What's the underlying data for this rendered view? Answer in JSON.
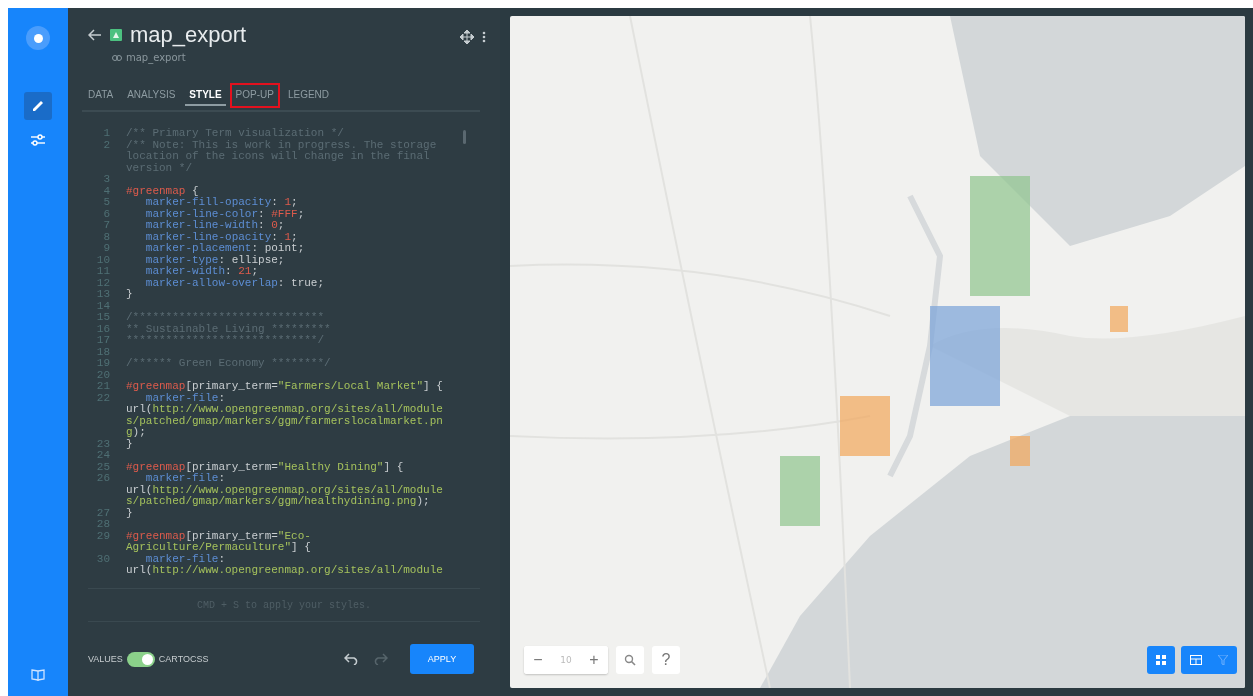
{
  "sidebar": {
    "items": [
      {
        "kind": "edit",
        "selected": true
      },
      {
        "kind": "settings",
        "selected": false
      }
    ]
  },
  "header": {
    "title": "map_export",
    "subtitle": "map_export"
  },
  "tabs": [
    {
      "label": "DATA",
      "selected": false,
      "highlighted": false
    },
    {
      "label": "ANALYSIS",
      "selected": false,
      "highlighted": false
    },
    {
      "label": "STYLE",
      "selected": true,
      "highlighted": false
    },
    {
      "label": "POP-UP",
      "selected": false,
      "highlighted": true
    },
    {
      "label": "LEGEND",
      "selected": false,
      "highlighted": false
    }
  ],
  "editor": {
    "lines": [
      {
        "num": "1",
        "parts": [
          {
            "kind": "comment",
            "text": "/** Primary Term visualization */"
          }
        ]
      },
      {
        "num": "2",
        "parts": [
          {
            "kind": "comment",
            "text": "/** Note: This is work in progress. The storage location of the icons will change in the final version */"
          }
        ]
      },
      {
        "num": "3"
      },
      {
        "num": "4",
        "parts": [
          {
            "kind": "selector",
            "text": "#greenmap"
          },
          {
            "kind": "plain",
            "text": " {"
          }
        ]
      },
      {
        "num": "5",
        "parts": [
          {
            "kind": "property",
            "text": "   marker-fill-opacity"
          },
          {
            "kind": "plain",
            "text": ": "
          },
          {
            "kind": "number",
            "text": "1"
          },
          {
            "kind": "plain",
            "text": ";"
          }
        ]
      },
      {
        "num": "6",
        "parts": [
          {
            "kind": "property",
            "text": "   marker-line-color"
          },
          {
            "kind": "plain",
            "text": ": "
          },
          {
            "kind": "number",
            "text": "#FFF"
          },
          {
            "kind": "plain",
            "text": ";"
          }
        ]
      },
      {
        "num": "7",
        "parts": [
          {
            "kind": "property",
            "text": "   marker-line-width"
          },
          {
            "kind": "plain",
            "text": ": "
          },
          {
            "kind": "number",
            "text": "0"
          },
          {
            "kind": "plain",
            "text": ";"
          }
        ]
      },
      {
        "num": "8",
        "parts": [
          {
            "kind": "property",
            "text": "   marker-line-opacity"
          },
          {
            "kind": "plain",
            "text": ": "
          },
          {
            "kind": "number",
            "text": "1"
          },
          {
            "kind": "plain",
            "text": ";"
          }
        ]
      },
      {
        "num": "9",
        "parts": [
          {
            "kind": "property",
            "text": "   marker-placement"
          },
          {
            "kind": "plain",
            "text": ": point;"
          }
        ]
      },
      {
        "num": "10",
        "parts": [
          {
            "kind": "property",
            "text": "   marker-type"
          },
          {
            "kind": "plain",
            "text": ": ellipse;"
          }
        ]
      },
      {
        "num": "11",
        "parts": [
          {
            "kind": "property",
            "text": "   marker-width"
          },
          {
            "kind": "plain",
            "text": ": "
          },
          {
            "kind": "number",
            "text": "21"
          },
          {
            "kind": "plain",
            "text": ";"
          }
        ]
      },
      {
        "num": "12",
        "parts": [
          {
            "kind": "property",
            "text": "   marker-allow-overlap"
          },
          {
            "kind": "plain",
            "text": ": true;"
          }
        ]
      },
      {
        "num": "13",
        "parts": [
          {
            "kind": "plain",
            "text": "}"
          }
        ]
      },
      {
        "num": "14"
      },
      {
        "num": "15",
        "parts": [
          {
            "kind": "comment",
            "text": "/*****************************"
          }
        ]
      },
      {
        "num": "16",
        "parts": [
          {
            "kind": "comment",
            "text": "** Sustainable Living *********"
          }
        ]
      },
      {
        "num": "17",
        "parts": [
          {
            "kind": "comment",
            "text": "*****************************/"
          }
        ]
      },
      {
        "num": "18"
      },
      {
        "num": "19",
        "parts": [
          {
            "kind": "comment",
            "text": "/****** Green Economy ********/"
          }
        ]
      },
      {
        "num": "20"
      },
      {
        "num": "21",
        "parts": [
          {
            "kind": "selector",
            "text": "#greenmap"
          },
          {
            "kind": "plain",
            "text": "[primary_term="
          },
          {
            "kind": "string",
            "text": "\"Farmers/Local Market\""
          },
          {
            "kind": "plain",
            "text": "] {"
          }
        ]
      },
      {
        "num": "22",
        "parts": [
          {
            "kind": "property",
            "text": "   marker-file"
          },
          {
            "kind": "plain",
            "text": ": url("
          },
          {
            "kind": "string",
            "text": "http://www.opengreenmap.org/sites/all/modules/patched/gmap/markers/ggm/farmerslocalmarket.png"
          },
          {
            "kind": "plain",
            "text": ");"
          }
        ]
      },
      {
        "num": "23",
        "parts": [
          {
            "kind": "plain",
            "text": "}"
          }
        ]
      },
      {
        "num": "24"
      },
      {
        "num": "25",
        "parts": [
          {
            "kind": "selector",
            "text": "#greenmap"
          },
          {
            "kind": "plain",
            "text": "[primary_term="
          },
          {
            "kind": "string",
            "text": "\"Healthy Dining\""
          },
          {
            "kind": "plain",
            "text": "] {"
          }
        ]
      },
      {
        "num": "26",
        "parts": [
          {
            "kind": "property",
            "text": "   marker-file"
          },
          {
            "kind": "plain",
            "text": ": url("
          },
          {
            "kind": "string",
            "text": "http://www.opengreenmap.org/sites/all/modules/patched/gmap/markers/ggm/healthydining.png"
          },
          {
            "kind": "plain",
            "text": ");"
          }
        ]
      },
      {
        "num": "27",
        "parts": [
          {
            "kind": "plain",
            "text": "}"
          }
        ]
      },
      {
        "num": "28"
      },
      {
        "num": "29",
        "parts": [
          {
            "kind": "selector",
            "text": "#greenmap"
          },
          {
            "kind": "plain",
            "text": "[primary_term="
          },
          {
            "kind": "string",
            "text": "\"Eco-Agriculture/Permaculture\""
          },
          {
            "kind": "plain",
            "text": "] {"
          }
        ]
      },
      {
        "num": "30",
        "parts": [
          {
            "kind": "property",
            "text": "   marker-file"
          },
          {
            "kind": "plain",
            "text": ": url("
          },
          {
            "kind": "string",
            "text": "http://www.opengreenmap.org/sites/all/module"
          }
        ]
      }
    ],
    "hint": "CMD + S to apply your styles."
  },
  "footer": {
    "toggle": {
      "left_label": "VALUES",
      "right_label": "CARTOCSS",
      "on": true
    },
    "undo": {
      "disabled": false
    },
    "redo": {
      "disabled": true
    },
    "apply": "APPLY"
  },
  "map": {
    "kind": "picture",
    "zoom": {
      "minus": "−",
      "level": "10",
      "plus": "+",
      "help": "?"
    }
  }
}
